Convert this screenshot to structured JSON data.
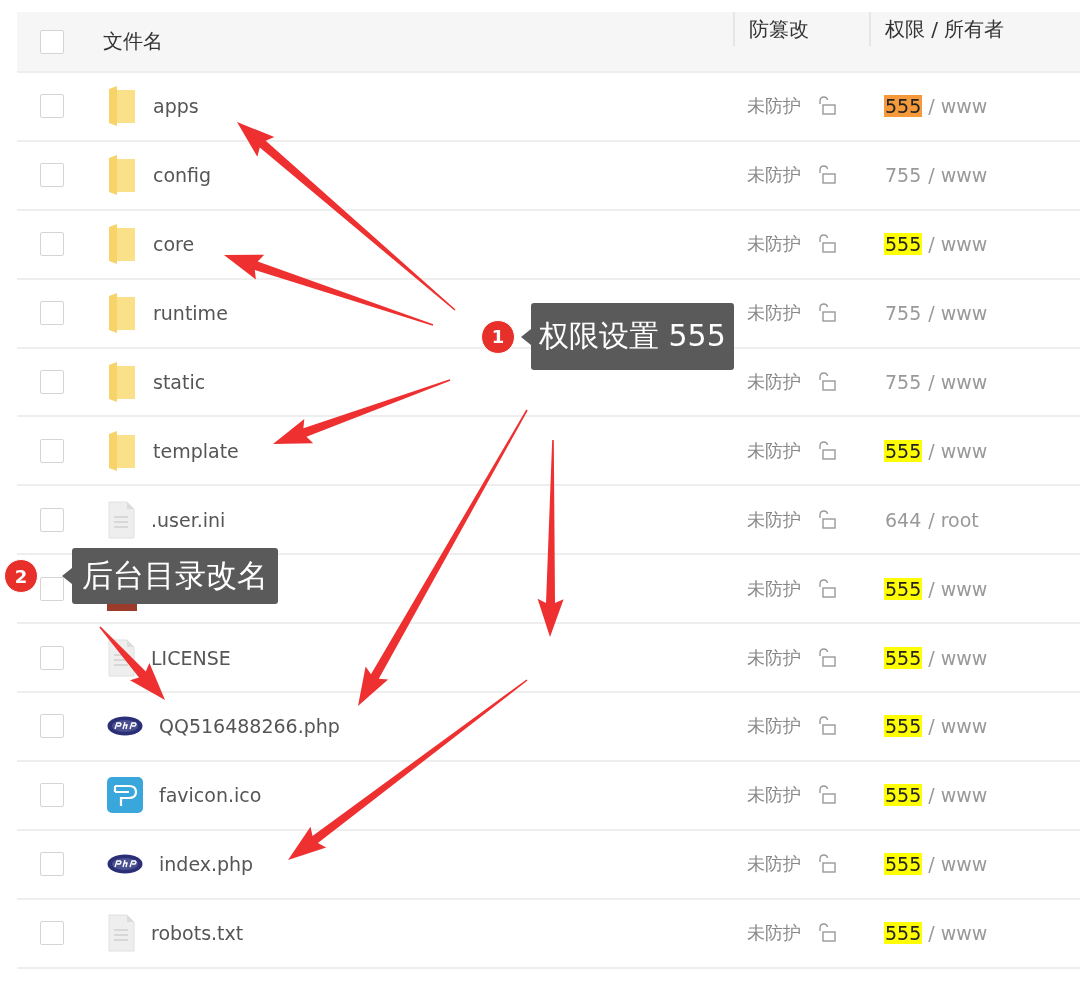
{
  "table": {
    "select_all": {
      "checked": false
    },
    "columns": [
      "文件名",
      "防篡改",
      "权限 / 所有者"
    ],
    "rows": [
      {
        "kind": "folder",
        "name": "apps",
        "checked": false,
        "protection": "未防护",
        "permission": "555",
        "owner_suffix": "/ www",
        "color": "#f59a3a"
      },
      {
        "kind": "folder",
        "name": "config",
        "checked": false,
        "protection": "未防护",
        "permission": "755",
        "owner_suffix": "/ www"
      },
      {
        "kind": "folder",
        "name": "core",
        "checked": false,
        "protection": "未防护",
        "permission": "555",
        "owner_suffix": "/ www",
        "color": "#ffff00"
      },
      {
        "kind": "folder",
        "name": "runtime",
        "checked": false,
        "protection": "未防护",
        "permission": "755",
        "owner_suffix": "/ www"
      },
      {
        "kind": "folder",
        "name": "static",
        "checked": false,
        "protection": "未防护",
        "permission": "755",
        "owner_suffix": "/ www"
      },
      {
        "kind": "folder",
        "name": "template",
        "checked": false,
        "protection": "未防护",
        "permission": "555",
        "owner_suffix": "/ www",
        "color": "#ffff00"
      },
      {
        "kind": "file",
        "name": ".user.ini",
        "checked": false,
        "protection": "未防护",
        "permission": "644",
        "owner_suffix": "/ root"
      },
      {
        "kind": "html",
        "checked": false,
        "protection": "未防护",
        "permission": "555",
        "owner_suffix": "/ www",
        "color": "#ffff00"
      },
      {
        "kind": "file",
        "name": "LICENSE",
        "checked": false,
        "protection": "未防护",
        "permission": "555",
        "owner_suffix": "/ www",
        "color": "#ffff00"
      },
      {
        "kind": "php",
        "name": "QQ516488266.php",
        "checked": false,
        "protection": "未防护",
        "permission": "555",
        "owner_suffix": "/ www",
        "color": "#ffff00"
      },
      {
        "kind": "image",
        "name": "favicon.ico",
        "checked": false,
        "protection": "未防护",
        "permission": "555",
        "owner_suffix": "/ www",
        "color": "#ffff00"
      },
      {
        "kind": "php",
        "name": "index.php",
        "checked": false,
        "protection": "未防护",
        "permission": "555",
        "owner_suffix": "/ www",
        "color": "#ffff00"
      },
      {
        "kind": "file",
        "name": "robots.txt",
        "checked": false,
        "protection": "未防护",
        "permission": "555",
        "owner_suffix": "/ www",
        "color": "#ffff00"
      }
    ]
  },
  "callouts": [
    {
      "number": "1",
      "text": "权限设置 555"
    },
    {
      "number": "2",
      "text": "后台目录改名"
    }
  ]
}
